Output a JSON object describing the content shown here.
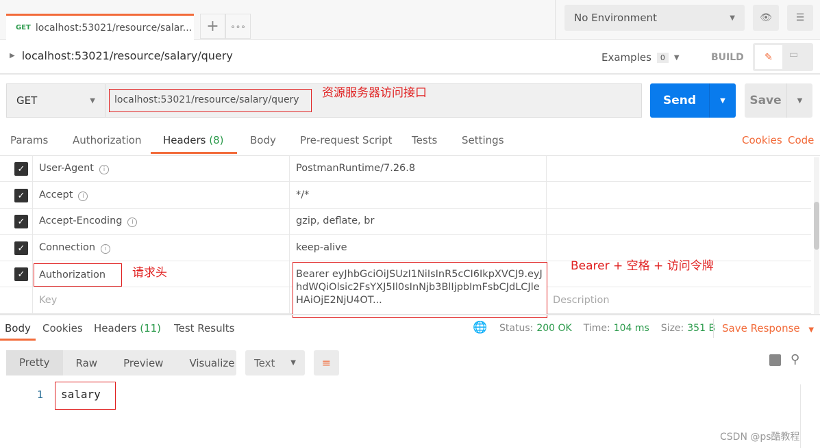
{
  "tab": {
    "method": "GET",
    "title": "localhost:53021/resource/salar..."
  },
  "environment": {
    "selected": "No Environment"
  },
  "breadcrumb": "localhost:53021/resource/salary/query",
  "examples": {
    "label": "Examples",
    "count": "0"
  },
  "build_label": "BUILD",
  "request": {
    "method": "GET",
    "url": "localhost:53021/resource/salary/query",
    "send": "Send",
    "save": "Save"
  },
  "annotations": {
    "url": "资源服务器访问接口",
    "header": "请求头",
    "bearer": "Bearer + 空格 + 访问令牌"
  },
  "request_tabs": [
    "Params",
    "Authorization",
    "Headers",
    "(8)",
    "Body",
    "Pre-request Script",
    "Tests",
    "Settings"
  ],
  "links": {
    "cookies": "Cookies",
    "code": "Code"
  },
  "headers": [
    {
      "key": "User-Agent",
      "value": "PostmanRuntime/7.26.8"
    },
    {
      "key": "Accept",
      "value": "*/*"
    },
    {
      "key": "Accept-Encoding",
      "value": "gzip, deflate, br"
    },
    {
      "key": "Connection",
      "value": "keep-alive"
    },
    {
      "key": "Authorization",
      "value": "Bearer eyJhbGciOiJSUzI1NiIsInR5cCI6IkpXVCJ9.eyJhdWQiOlsic2FsYXJ5Il0sInNjb3BlIjpbImFsbCJdLCJleHAiOjE2NjU4OT..."
    }
  ],
  "new_row": {
    "key_placeholder": "Key",
    "desc_placeholder": "Description"
  },
  "response_tabs": {
    "body": "Body",
    "cookies": "Cookies",
    "headers": "Headers",
    "headers_count": "(11)",
    "tests": "Test Results"
  },
  "status": {
    "status_label": "Status:",
    "status": "200 OK",
    "time_label": "Time:",
    "time": "104 ms",
    "size_label": "Size:",
    "size": "351 B",
    "save_response": "Save Response"
  },
  "view_modes": [
    "Pretty",
    "Raw",
    "Preview",
    "Visualize"
  ],
  "format": "Text",
  "body": {
    "line": "1",
    "content": "salary"
  },
  "watermark": "CSDN @ps酷教程"
}
